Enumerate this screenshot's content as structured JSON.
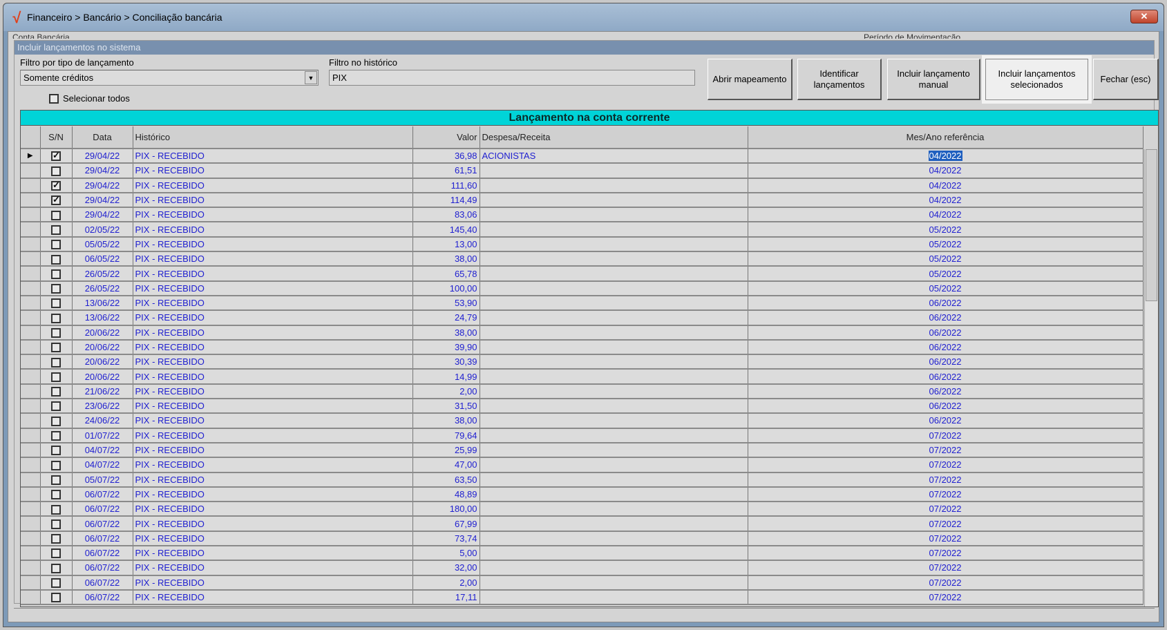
{
  "window": {
    "title": "Financeiro > Bancário > Conciliação bancária",
    "close": "✕"
  },
  "behind": {
    "left": "Conta Bancária",
    "right": "Período de Movimentação"
  },
  "panel": {
    "title": "Incluir lançamentos no sistema"
  },
  "filters": {
    "type_label": "Filtro por tipo de lançamento",
    "type_value": "Somente créditos",
    "hist_label": "Filtro no histórico",
    "hist_value": "PIX",
    "select_all": "Selecionar todos"
  },
  "buttons": {
    "abrir": "Abrir mapeamento",
    "identificar": "Identificar lançamentos",
    "manual": "Incluir lançamento manual",
    "selecionados": "Incluir lançamentos selecionados",
    "fechar": "Fechar (esc)"
  },
  "grid": {
    "title": "Lançamento na conta corrente",
    "columns": [
      "S/N",
      "Data",
      "Histórico",
      "Valor",
      "Despesa/Receita",
      "Mes/Ano referência"
    ],
    "rows": [
      {
        "sel": true,
        "data": "29/04/22",
        "hist": "PIX - RECEBIDO",
        "valor": "36,98",
        "desp": "ACIONISTAS",
        "mes": "04/2022",
        "current": true
      },
      {
        "sel": false,
        "data": "29/04/22",
        "hist": "PIX - RECEBIDO",
        "valor": "61,51",
        "desp": "",
        "mes": "04/2022"
      },
      {
        "sel": true,
        "data": "29/04/22",
        "hist": "PIX - RECEBIDO",
        "valor": "111,60",
        "desp": "",
        "mes": "04/2022"
      },
      {
        "sel": true,
        "data": "29/04/22",
        "hist": "PIX - RECEBIDO",
        "valor": "114,49",
        "desp": "",
        "mes": "04/2022"
      },
      {
        "sel": false,
        "data": "29/04/22",
        "hist": "PIX - RECEBIDO",
        "valor": "83,06",
        "desp": "",
        "mes": "04/2022"
      },
      {
        "sel": false,
        "data": "02/05/22",
        "hist": "PIX - RECEBIDO",
        "valor": "145,40",
        "desp": "",
        "mes": "05/2022"
      },
      {
        "sel": false,
        "data": "05/05/22",
        "hist": "PIX - RECEBIDO",
        "valor": "13,00",
        "desp": "",
        "mes": "05/2022"
      },
      {
        "sel": false,
        "data": "06/05/22",
        "hist": "PIX - RECEBIDO",
        "valor": "38,00",
        "desp": "",
        "mes": "05/2022"
      },
      {
        "sel": false,
        "data": "26/05/22",
        "hist": "PIX - RECEBIDO",
        "valor": "65,78",
        "desp": "",
        "mes": "05/2022"
      },
      {
        "sel": false,
        "data": "26/05/22",
        "hist": "PIX - RECEBIDO",
        "valor": "100,00",
        "desp": "",
        "mes": "05/2022"
      },
      {
        "sel": false,
        "data": "13/06/22",
        "hist": "PIX - RECEBIDO",
        "valor": "53,90",
        "desp": "",
        "mes": "06/2022"
      },
      {
        "sel": false,
        "data": "13/06/22",
        "hist": "PIX - RECEBIDO",
        "valor": "24,79",
        "desp": "",
        "mes": "06/2022"
      },
      {
        "sel": false,
        "data": "20/06/22",
        "hist": "PIX - RECEBIDO",
        "valor": "38,00",
        "desp": "",
        "mes": "06/2022"
      },
      {
        "sel": false,
        "data": "20/06/22",
        "hist": "PIX - RECEBIDO",
        "valor": "39,90",
        "desp": "",
        "mes": "06/2022"
      },
      {
        "sel": false,
        "data": "20/06/22",
        "hist": "PIX - RECEBIDO",
        "valor": "30,39",
        "desp": "",
        "mes": "06/2022"
      },
      {
        "sel": false,
        "data": "20/06/22",
        "hist": "PIX - RECEBIDO",
        "valor": "14,99",
        "desp": "",
        "mes": "06/2022"
      },
      {
        "sel": false,
        "data": "21/06/22",
        "hist": "PIX - RECEBIDO",
        "valor": "2,00",
        "desp": "",
        "mes": "06/2022"
      },
      {
        "sel": false,
        "data": "23/06/22",
        "hist": "PIX - RECEBIDO",
        "valor": "31,50",
        "desp": "",
        "mes": "06/2022"
      },
      {
        "sel": false,
        "data": "24/06/22",
        "hist": "PIX - RECEBIDO",
        "valor": "38,00",
        "desp": "",
        "mes": "06/2022"
      },
      {
        "sel": false,
        "data": "01/07/22",
        "hist": "PIX - RECEBIDO",
        "valor": "79,64",
        "desp": "",
        "mes": "07/2022"
      },
      {
        "sel": false,
        "data": "04/07/22",
        "hist": "PIX - RECEBIDO",
        "valor": "25,99",
        "desp": "",
        "mes": "07/2022"
      },
      {
        "sel": false,
        "data": "04/07/22",
        "hist": "PIX - RECEBIDO",
        "valor": "47,00",
        "desp": "",
        "mes": "07/2022"
      },
      {
        "sel": false,
        "data": "05/07/22",
        "hist": "PIX - RECEBIDO",
        "valor": "63,50",
        "desp": "",
        "mes": "07/2022"
      },
      {
        "sel": false,
        "data": "06/07/22",
        "hist": "PIX - RECEBIDO",
        "valor": "48,89",
        "desp": "",
        "mes": "07/2022"
      },
      {
        "sel": false,
        "data": "06/07/22",
        "hist": "PIX - RECEBIDO",
        "valor": "180,00",
        "desp": "",
        "mes": "07/2022"
      },
      {
        "sel": false,
        "data": "06/07/22",
        "hist": "PIX - RECEBIDO",
        "valor": "67,99",
        "desp": "",
        "mes": "07/2022"
      },
      {
        "sel": false,
        "data": "06/07/22",
        "hist": "PIX - RECEBIDO",
        "valor": "73,74",
        "desp": "",
        "mes": "07/2022"
      },
      {
        "sel": false,
        "data": "06/07/22",
        "hist": "PIX - RECEBIDO",
        "valor": "5,00",
        "desp": "",
        "mes": "07/2022"
      },
      {
        "sel": false,
        "data": "06/07/22",
        "hist": "PIX - RECEBIDO",
        "valor": "32,00",
        "desp": "",
        "mes": "07/2022"
      },
      {
        "sel": false,
        "data": "06/07/22",
        "hist": "PIX - RECEBIDO",
        "valor": "2,00",
        "desp": "",
        "mes": "07/2022"
      },
      {
        "sel": false,
        "data": "06/07/22",
        "hist": "PIX - RECEBIDO",
        "valor": "17,11",
        "desp": "",
        "mes": "07/2022"
      }
    ]
  }
}
